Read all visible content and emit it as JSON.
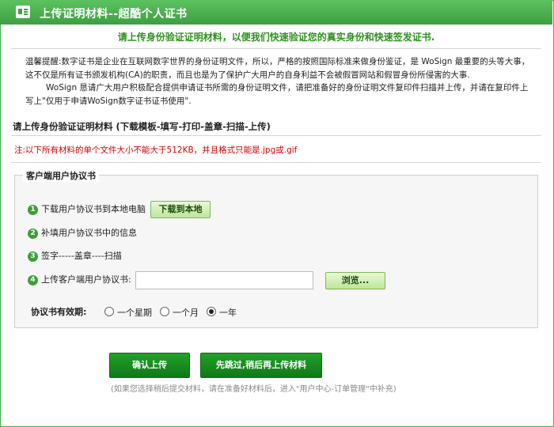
{
  "window": {
    "title": "上传证明材料--超酷个人证书"
  },
  "headline": "请上传身份验证证明材料，以便我们快速验证您的真实身份和快速签发证书.",
  "tip": {
    "p1": "温馨提醒:数字证书是企业在互联网数字世界的身份证明文件，所以，严格的按照国际标准来做身份鉴证，是 WoSign 最重要的头等大事，这不仅是所有证书颁发机构(CA)的职责，而且也是为了保护广大用户的自身利益不会被假冒网站和假冒身份所侵害的大事.",
    "p2": "WoSign 恳请广大用户积极配合提供申请证书所需的身份证明文件，请把准备好的身份证明文件复印件扫描并上传，并请在复印件上写上\"仅用于申请WoSign数字证书证书使用\"."
  },
  "section_title": "请上传身份验证证明材料 (下载模板-填写-打印-盖章-扫描-上传)",
  "note": "注:以下所有材料的单个文件大小不能大于512KB，并且格式只能是.jpg或.gif",
  "agreement": {
    "title": "客户端用户协议书",
    "steps": [
      {
        "num": "1",
        "text": "下载用户协议书到本地电脑"
      },
      {
        "num": "2",
        "text": "补填用户协议书中的信息"
      },
      {
        "num": "3",
        "text": "签字-----盖章----扫描"
      },
      {
        "num": "4",
        "text": "上传客户端用户协议书:"
      }
    ],
    "download_label": "下载到本地",
    "file_value": "",
    "browse_label": "浏览...",
    "validity_label": "协议书有效期:",
    "options": [
      "一个星期",
      "一个月",
      "一年"
    ],
    "selected_option": "一年"
  },
  "buttons": {
    "confirm": "确认上传",
    "skip": "先跳过,稍后再上传材料"
  },
  "footer_note": "(如果您选择稍后提交材料，请在准备好材料后，进入\"用户中心-订单管理\"中补充)",
  "colors": {
    "brand_green": "#3e9f42",
    "headline_green": "#2f8f1e",
    "warning_red": "#d40000"
  }
}
